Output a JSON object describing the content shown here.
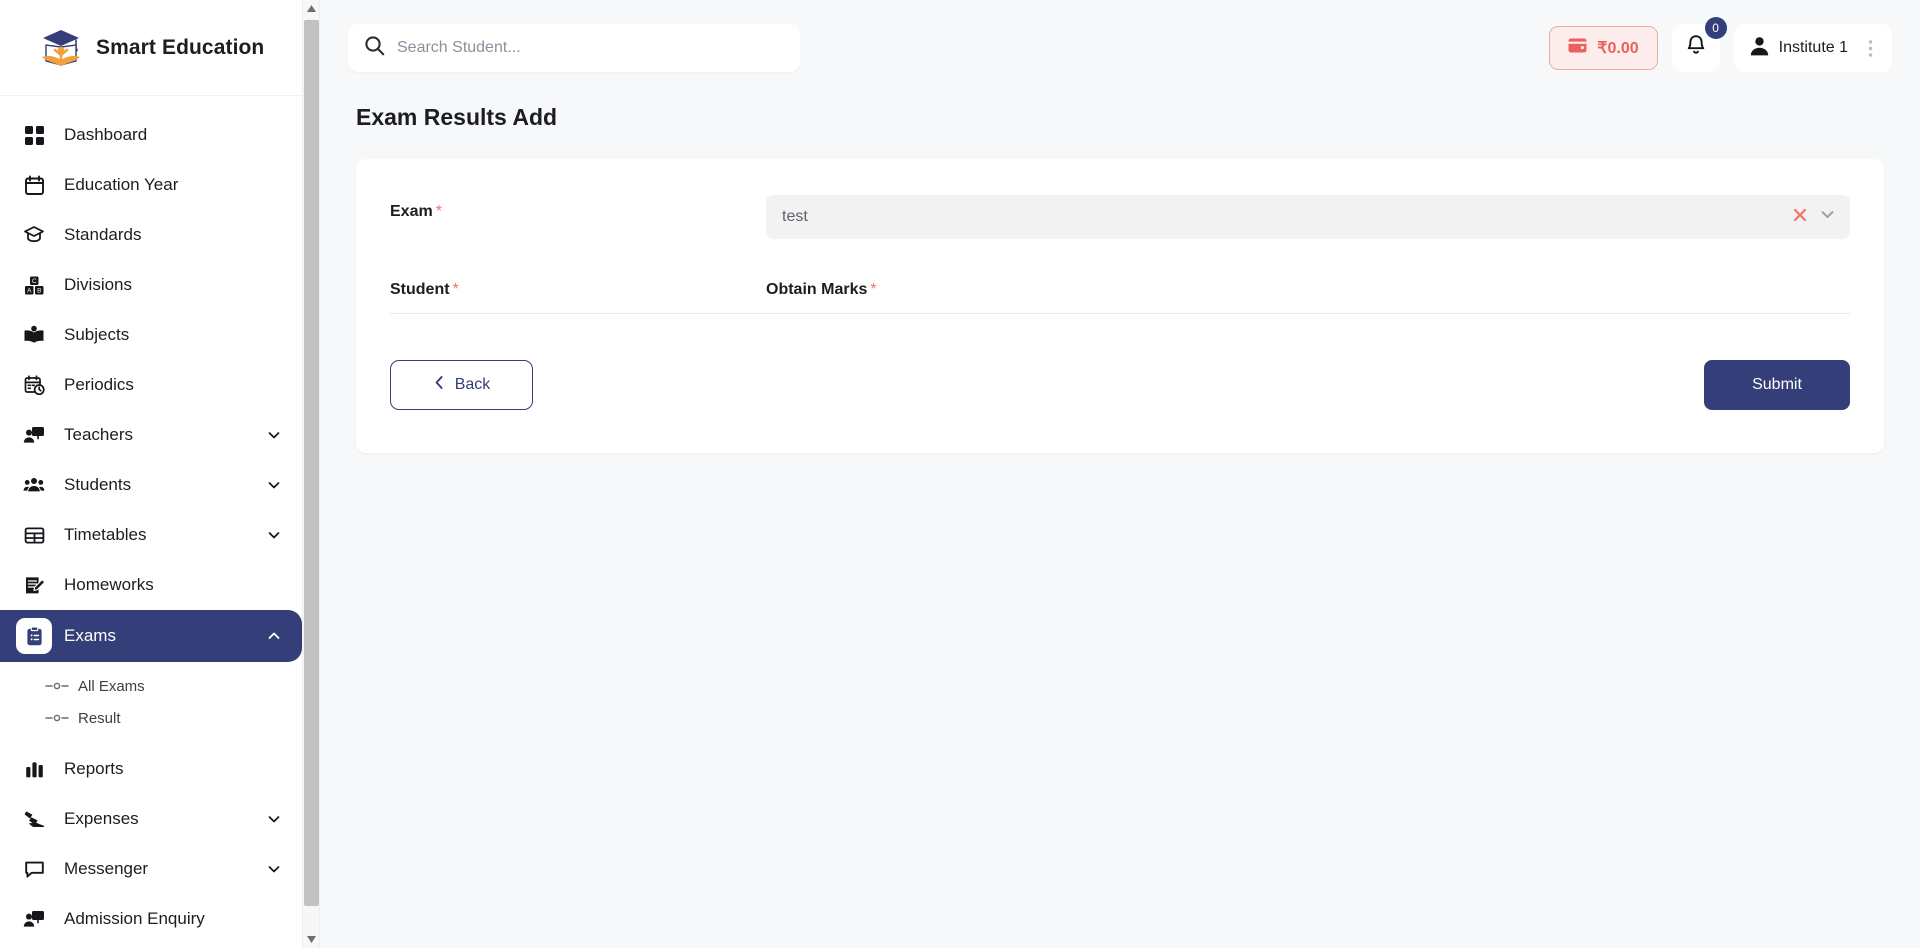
{
  "brand": {
    "title": "Smart Education",
    "logo_icon": "graduation-cap-book-logo"
  },
  "sidebar": {
    "items": [
      {
        "label": "Dashboard",
        "icon": "grid-icon",
        "expandable": false,
        "active": false
      },
      {
        "label": "Education Year",
        "icon": "calendar-icon",
        "expandable": false,
        "active": false
      },
      {
        "label": "Standards",
        "icon": "graduation-cap-icon",
        "expandable": false,
        "active": false
      },
      {
        "label": "Divisions",
        "icon": "blocks-icon",
        "expandable": false,
        "active": false
      },
      {
        "label": "Subjects",
        "icon": "open-book-icon",
        "expandable": false,
        "active": false
      },
      {
        "label": "Periodics",
        "icon": "calendar-clock-icon",
        "expandable": false,
        "active": false
      },
      {
        "label": "Teachers",
        "icon": "presentation-person-icon",
        "expandable": true,
        "active": false
      },
      {
        "label": "Students",
        "icon": "users-icon",
        "expandable": true,
        "active": false
      },
      {
        "label": "Timetables",
        "icon": "table-icon",
        "expandable": true,
        "active": false
      },
      {
        "label": "Homeworks",
        "icon": "note-pencil-icon",
        "expandable": false,
        "active": false
      },
      {
        "label": "Exams",
        "icon": "clipboard-list-icon",
        "expandable": true,
        "active": true
      },
      {
        "label": "Reports",
        "icon": "bar-chart-icon",
        "expandable": false,
        "active": false
      },
      {
        "label": "Expenses",
        "icon": "money-hand-icon",
        "expandable": true,
        "active": false
      },
      {
        "label": "Messenger",
        "icon": "chat-bubble-icon",
        "expandable": true,
        "active": false
      },
      {
        "label": "Admission Enquiry",
        "icon": "presentation-person-icon",
        "expandable": false,
        "active": false
      }
    ],
    "exams_submenu": [
      {
        "label": "All Exams"
      },
      {
        "label": "Result"
      }
    ],
    "scrollbar": {
      "up_arrow": "▲",
      "down_arrow": "▼"
    }
  },
  "topbar": {
    "search": {
      "placeholder": "Search Student...",
      "value": "",
      "icon": "search-icon"
    },
    "wallet": {
      "label": "₹0.00",
      "icon": "wallet-icon",
      "color": "#e9615c"
    },
    "notifications": {
      "count": "0",
      "icon": "bell-icon",
      "badge_color": "#343E78"
    },
    "user": {
      "name": "Institute 1",
      "icon": "user-icon",
      "menu_icon": "kebab-menu-icon"
    }
  },
  "page": {
    "title": "Exam Results Add"
  },
  "form": {
    "exam": {
      "label": "Exam",
      "required_marker": "*",
      "value": "test",
      "clear_icon": "close-x-icon",
      "dropdown_icon": "chevron-down-icon"
    },
    "student": {
      "label": "Student",
      "required_marker": "*"
    },
    "obtain_marks": {
      "label": "Obtain Marks",
      "required_marker": "*"
    }
  },
  "actions": {
    "back_label": "Back",
    "back_icon": "chevron-left-icon",
    "submit_label": "Submit"
  },
  "colors": {
    "primary_navy": "#343E78",
    "danger_red": "#e9615c",
    "page_bg": "#f7f8fa",
    "card_bg": "#ffffff"
  }
}
